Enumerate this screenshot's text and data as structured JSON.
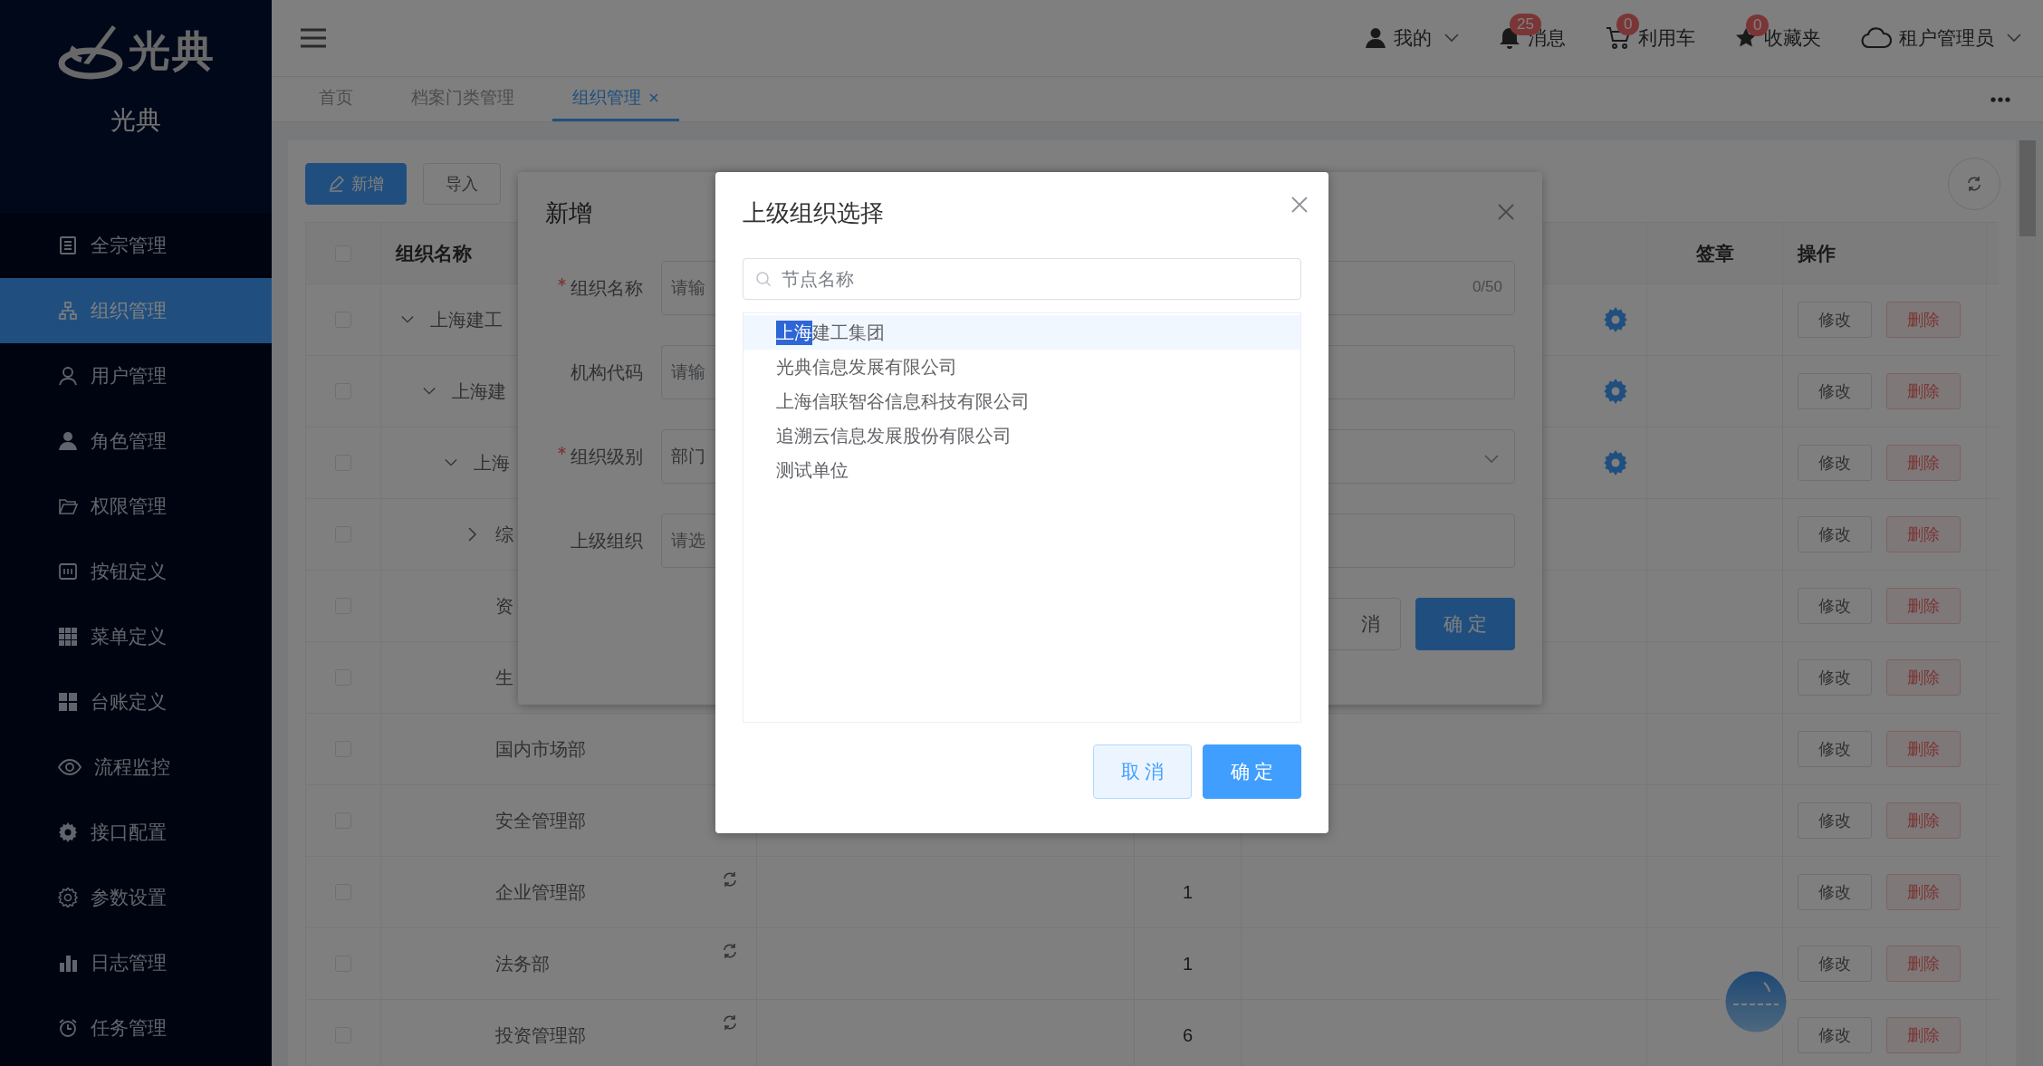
{
  "sidebar": {
    "logo_text": "光典",
    "subtitle": "光典",
    "items": [
      {
        "label": "全宗管理",
        "selected": false
      },
      {
        "label": "组织管理",
        "selected": true
      },
      {
        "label": "用户管理",
        "selected": false
      },
      {
        "label": "角色管理",
        "selected": false
      },
      {
        "label": "权限管理",
        "selected": false
      },
      {
        "label": "按钮定义",
        "selected": false
      },
      {
        "label": "菜单定义",
        "selected": false
      },
      {
        "label": "台账定义",
        "selected": false
      },
      {
        "label": "流程监控",
        "selected": false
      },
      {
        "label": "接口配置",
        "selected": false
      },
      {
        "label": "参数设置",
        "selected": false
      },
      {
        "label": "日志管理",
        "selected": false
      },
      {
        "label": "任务管理",
        "selected": false
      }
    ]
  },
  "header": {
    "items": [
      {
        "kind": "user",
        "label": "我的"
      },
      {
        "kind": "messages",
        "label": "消息",
        "badge": "25"
      },
      {
        "kind": "cart",
        "label": "利用车",
        "badge": "0"
      },
      {
        "kind": "favorites",
        "label": "收藏夹",
        "badge": "0"
      },
      {
        "kind": "tenant",
        "label": "租户管理员"
      }
    ]
  },
  "tabs": [
    {
      "label": "首页",
      "selected": false,
      "closable": false
    },
    {
      "label": "档案门类管理",
      "selected": false,
      "closable": false
    },
    {
      "label": "组织管理",
      "selected": true,
      "closable": true
    }
  ],
  "toolbar": {
    "buttons": [
      {
        "label": "新增",
        "kind": "primary"
      },
      {
        "label": "导入",
        "kind": "default"
      }
    ]
  },
  "table": {
    "select_all_checked": false,
    "columns": [
      {
        "header": "组织名称"
      },
      {
        "header": "签章"
      },
      {
        "header": "操作"
      }
    ],
    "rows": [
      {
        "name": "上海建工",
        "expanded": true,
        "checked": false,
        "settings_icon": true,
        "actions": [
          "修改",
          "删除"
        ],
        "children": [
          {
            "name": "上海建",
            "expanded": true,
            "checked": false,
            "settings_icon": true,
            "actions": [
              "修改",
              "删除"
            ],
            "children": [
              {
                "name": "上海",
                "expanded": true,
                "checked": false,
                "settings_icon": true,
                "actions": [
                  "修改",
                  "删除"
                ],
                "children": [
                  {
                    "name": "综",
                    "expanded": false,
                    "checked": false,
                    "actions": [
                      "修改",
                      "删除"
                    ]
                  },
                  {
                    "name": "资",
                    "checked": false,
                    "actions": [
                      "修改",
                      "删除"
                    ]
                  },
                  {
                    "name": "生",
                    "checked": false,
                    "actions": [
                      "修改",
                      "删除"
                    ]
                  },
                  {
                    "name": "国内市场部",
                    "checked": false,
                    "actions": [
                      "修改",
                      "删除"
                    ]
                  },
                  {
                    "name": "安全管理部",
                    "checked": false,
                    "actions": [
                      "修改",
                      "删除"
                    ]
                  },
                  {
                    "name": "企业管理部",
                    "checked": false,
                    "sync_icon": true,
                    "count": "1",
                    "actions": [
                      "修改",
                      "删除"
                    ]
                  },
                  {
                    "name": "法务部",
                    "checked": false,
                    "sync_icon": true,
                    "count": "1",
                    "actions": [
                      "修改",
                      "删除"
                    ]
                  },
                  {
                    "name": "投资管理部",
                    "checked": false,
                    "sync_icon": true,
                    "count": "6",
                    "actions": [
                      "修改",
                      "删除"
                    ]
                  }
                ]
              }
            ]
          }
        ]
      }
    ]
  },
  "dialog": {
    "title": "新增",
    "fields": [
      {
        "kind": "text",
        "label": "组织名称",
        "required": true,
        "placeholder": "请输",
        "counter": "0/50"
      },
      {
        "kind": "text",
        "label": "机构代码",
        "required": false,
        "placeholder": "请输"
      },
      {
        "kind": "select",
        "label": "组织级别",
        "required": true,
        "value": "部门"
      },
      {
        "kind": "text",
        "label": "上级组织",
        "required": false,
        "placeholder": "请选"
      }
    ],
    "buttons": [
      {
        "label": "消",
        "kind": "default"
      },
      {
        "label": "确 定",
        "kind": "primary"
      }
    ]
  },
  "modal": {
    "title": "上级组织选择",
    "search": {
      "placeholder": "节点名称"
    },
    "nodes": [
      {
        "selected_text": "上海",
        "label": "建工集团",
        "selected": true
      },
      {
        "label": "光典信息发展有限公司",
        "selected": false
      },
      {
        "label": "上海信联智谷信息科技有限公司",
        "selected": false
      },
      {
        "label": "追溯云信息发展股份有限公司",
        "selected": false
      },
      {
        "label": "测试单位",
        "selected": false
      }
    ],
    "buttons": [
      {
        "label": "取 消",
        "kind": "default"
      },
      {
        "label": "确 定",
        "kind": "primary"
      }
    ]
  }
}
